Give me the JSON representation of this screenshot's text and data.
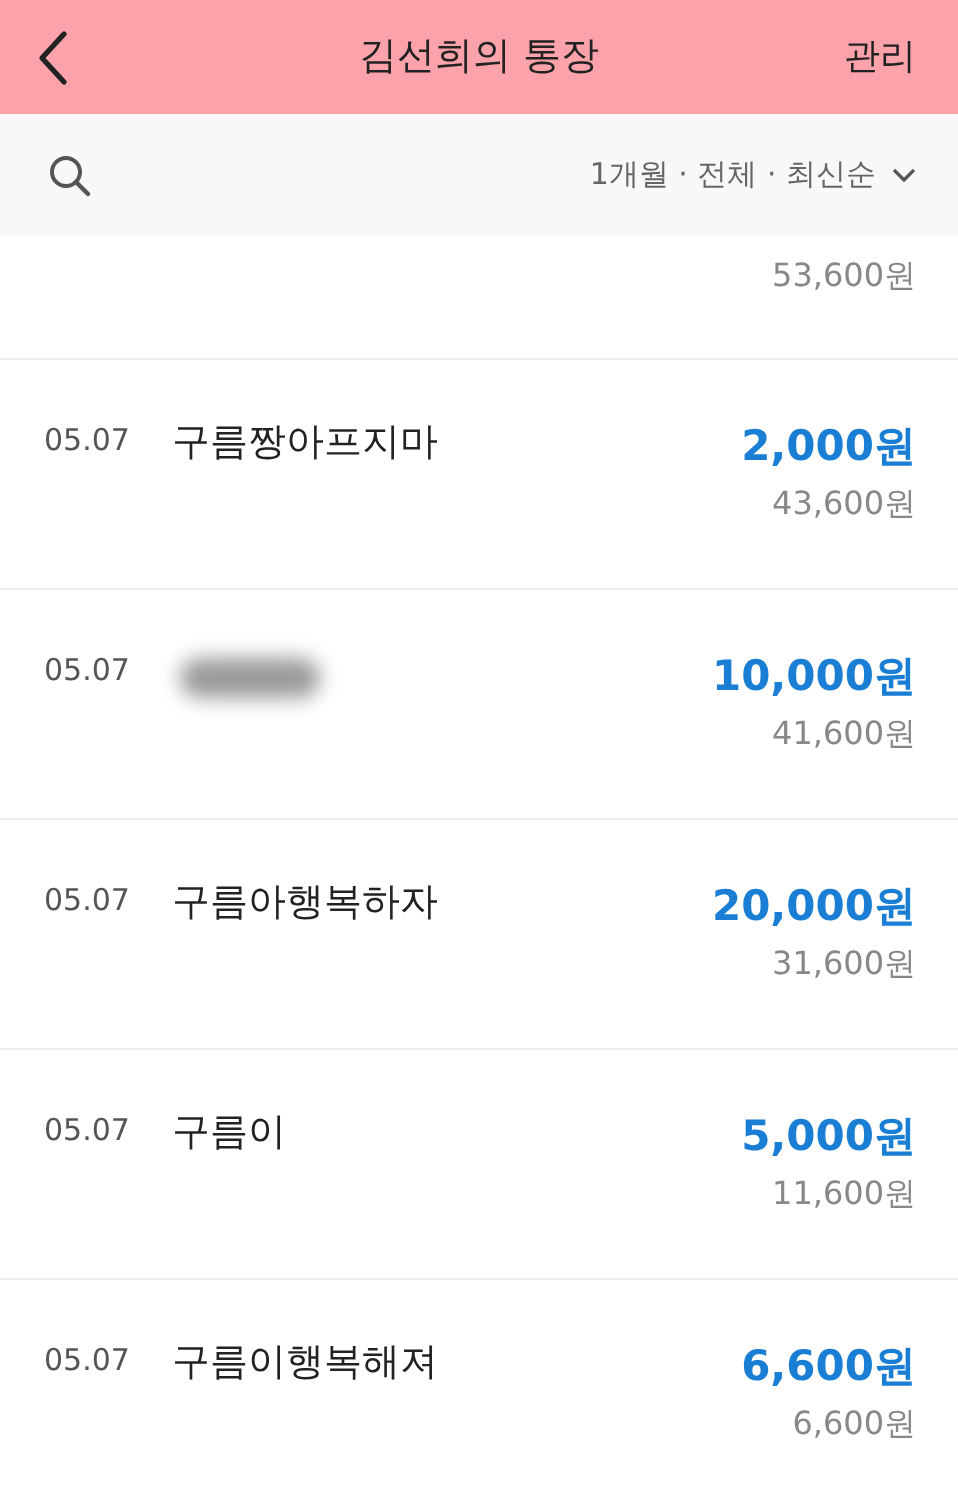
{
  "header": {
    "title": "김선희의 통장",
    "action": "관리"
  },
  "filter": {
    "label": "1개월 · 전체 · 최신순"
  },
  "partial_row": {
    "balance": "53,600원"
  },
  "transactions": [
    {
      "date": "05.07",
      "name": "구름짱아프지마",
      "redacted": false,
      "amount": "2,000원",
      "balance": "43,600원"
    },
    {
      "date": "05.07",
      "redacted": true,
      "amount": "10,000원",
      "balance": "41,600원"
    },
    {
      "date": "05.07",
      "name": "구름아행복하자",
      "redacted": false,
      "amount": "20,000원",
      "balance": "31,600원"
    },
    {
      "date": "05.07",
      "name": "구름이",
      "redacted": false,
      "amount": "5,000원",
      "balance": "11,600원"
    },
    {
      "date": "05.07",
      "name": "구름이행복해져",
      "redacted": false,
      "amount": "6,600원",
      "balance": "6,600원"
    }
  ]
}
